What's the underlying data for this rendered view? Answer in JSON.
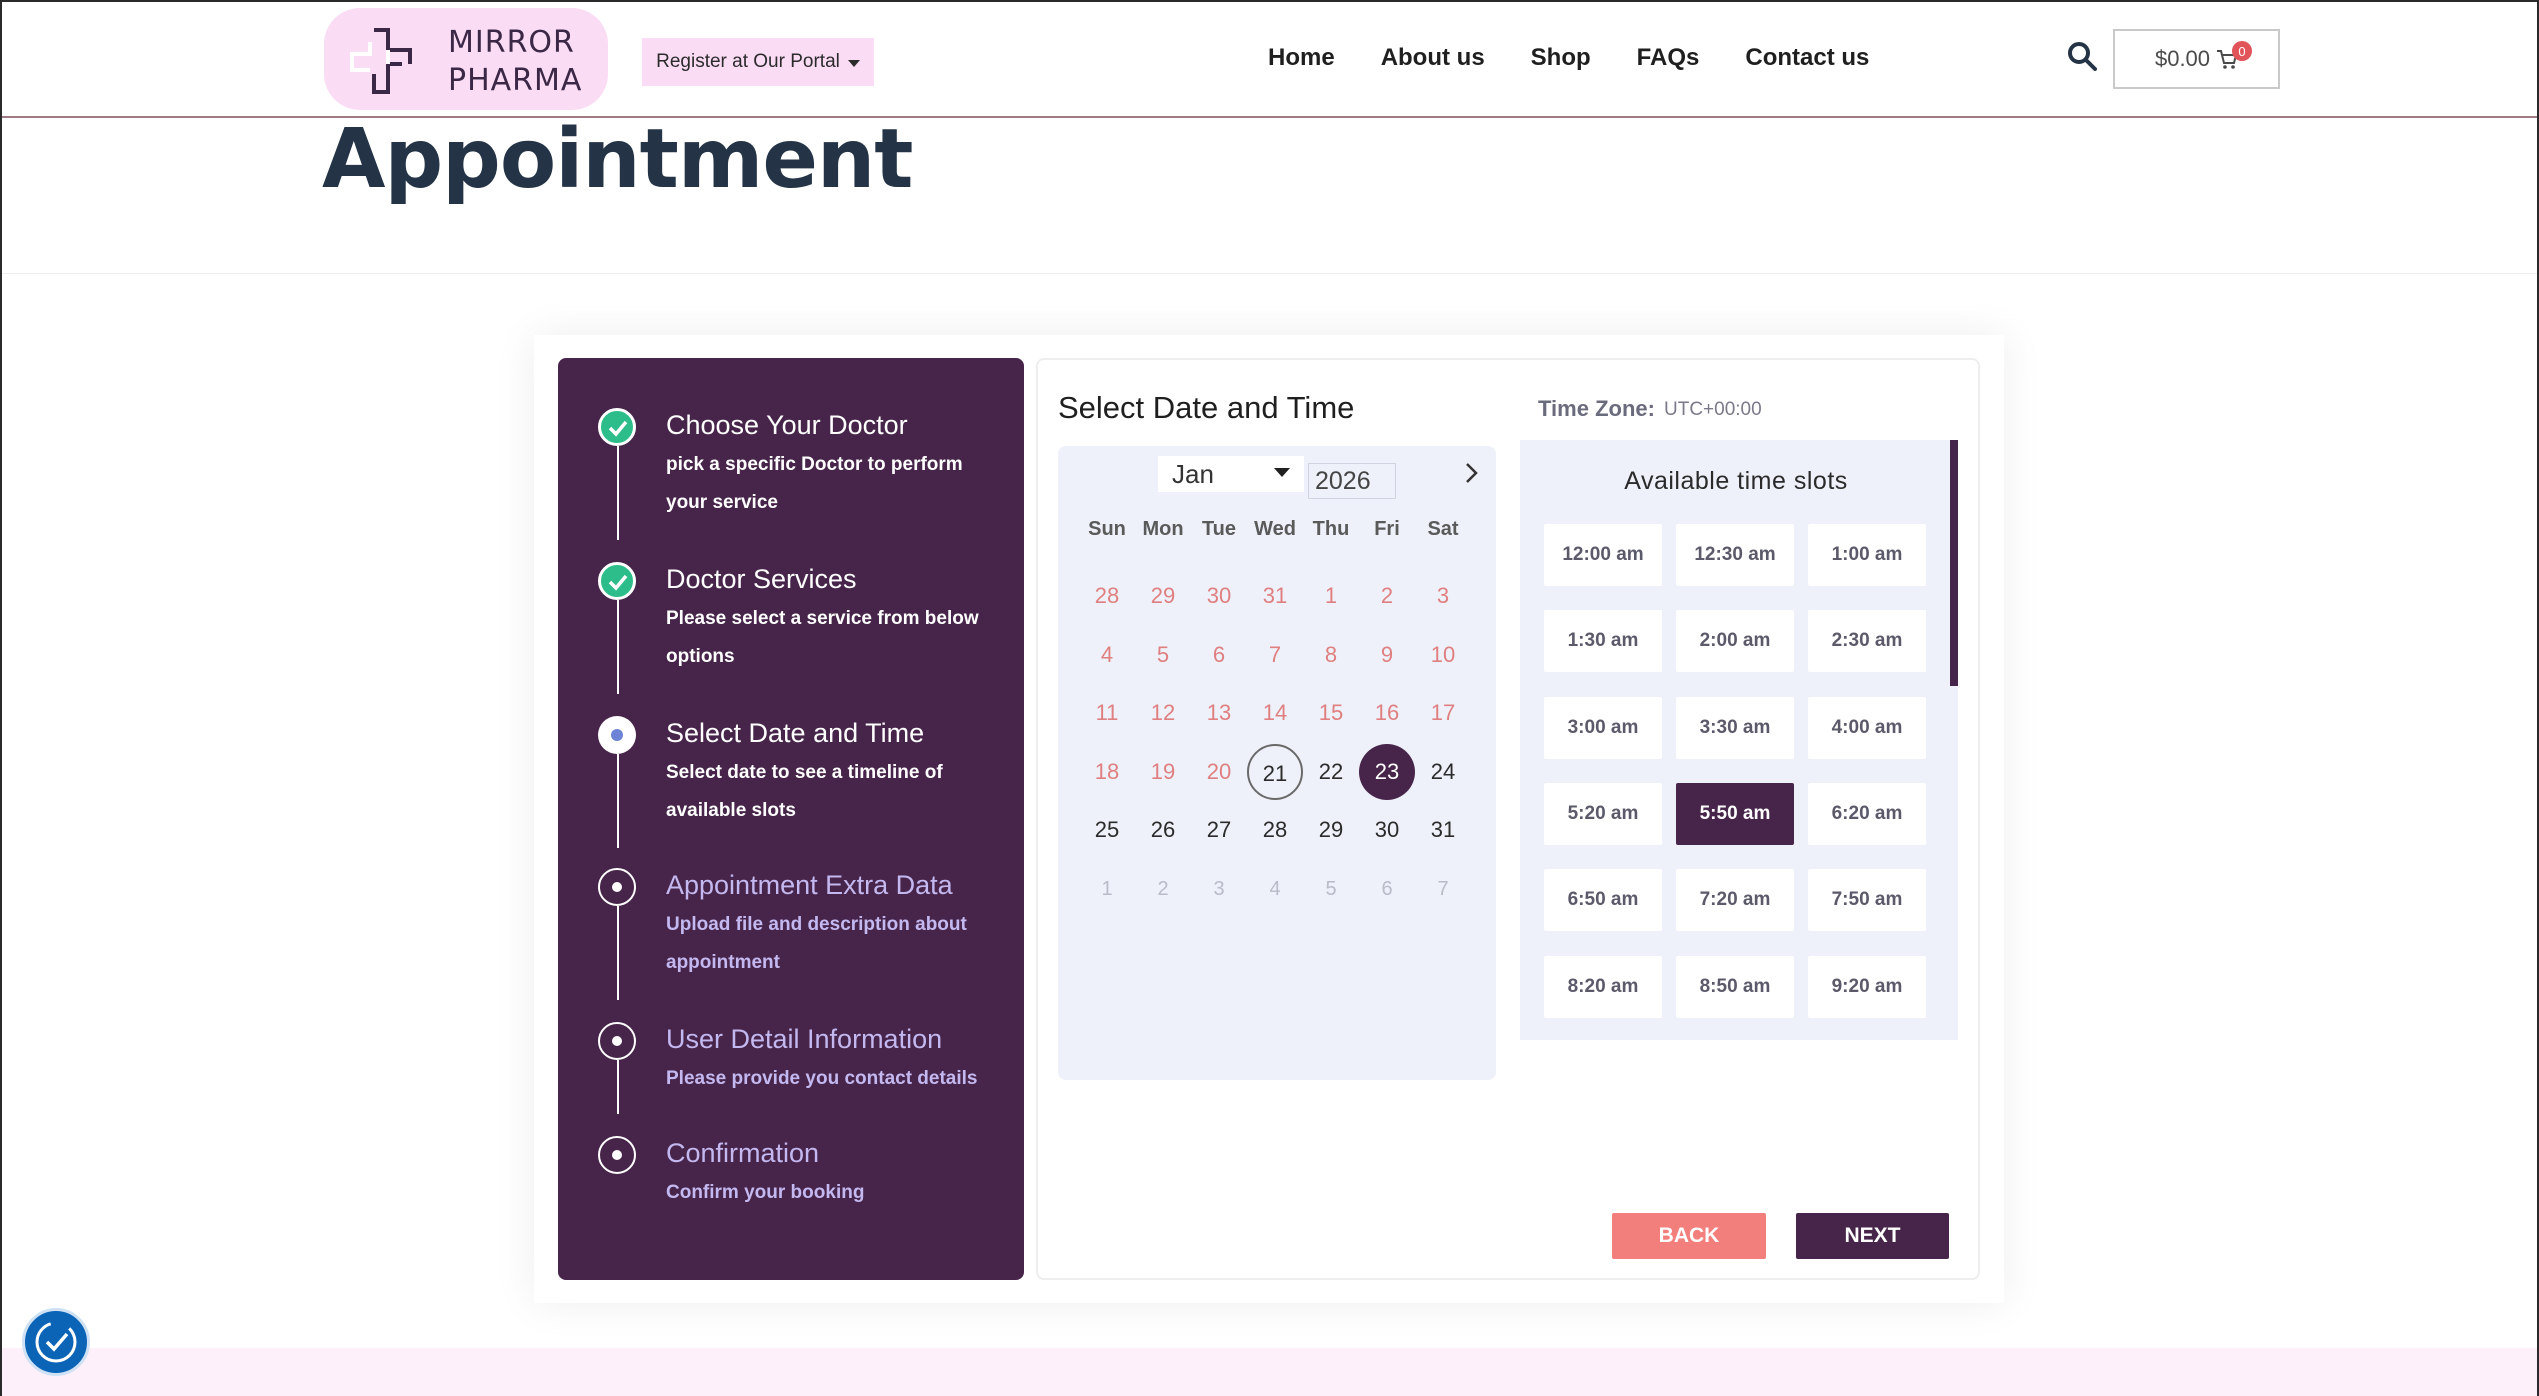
{
  "header": {
    "logo_line1": "MIRROR",
    "logo_line2": "PHARMA",
    "portal_label": "Register at Our Portal",
    "nav": [
      "Home",
      "About us",
      "Shop",
      "FAQs",
      "Contact us"
    ],
    "cart_total": "$0.00",
    "cart_count": "0"
  },
  "page": {
    "title": "Appointment"
  },
  "steps": [
    {
      "title": "Choose Your Doctor",
      "desc": "pick a specific Doctor to perform your service",
      "state": "done"
    },
    {
      "title": "Doctor Services",
      "desc": "Please select a service from below options",
      "state": "done"
    },
    {
      "title": "Select Date and Time",
      "desc": "Select date to see a timeline of available slots",
      "state": "current"
    },
    {
      "title": "Appointment Extra Data",
      "desc": "Upload file and description about appointment",
      "state": "pending"
    },
    {
      "title": "User Detail Information",
      "desc": "Please provide you contact details",
      "state": "pending"
    },
    {
      "title": "Confirmation",
      "desc": "Confirm your booking",
      "state": "pending"
    }
  ],
  "datetime": {
    "section_title": "Select Date and Time",
    "timezone_label": "Time Zone:",
    "timezone_value": "UTC+00:00"
  },
  "calendar": {
    "month": "Jan",
    "year": "2026",
    "weekdays": [
      "Sun",
      "Mon",
      "Tue",
      "Wed",
      "Thu",
      "Fri",
      "Sat"
    ],
    "weeks": [
      [
        "28",
        "29",
        "30",
        "31",
        "1",
        "2",
        "3"
      ],
      [
        "4",
        "5",
        "6",
        "7",
        "8",
        "9",
        "10"
      ],
      [
        "11",
        "12",
        "13",
        "14",
        "15",
        "16",
        "17"
      ],
      [
        "18",
        "19",
        "20",
        "21",
        "22",
        "23",
        "24"
      ],
      [
        "25",
        "26",
        "27",
        "28",
        "29",
        "30",
        "31"
      ],
      [
        "1",
        "2",
        "3",
        "4",
        "5",
        "6",
        "7"
      ]
    ],
    "today": "21",
    "selected": "23"
  },
  "slots": {
    "title": "Available time slots",
    "times": [
      "12:00 am",
      "12:30 am",
      "1:00 am",
      "1:30 am",
      "2:00 am",
      "2:30 am",
      "3:00 am",
      "3:30 am",
      "4:00 am",
      "5:20 am",
      "5:50 am",
      "6:20 am",
      "6:50 am",
      "7:20 am",
      "7:50 am",
      "8:20 am",
      "8:50 am",
      "9:20 am"
    ],
    "selected": "5:50 am"
  },
  "buttons": {
    "back": "BACK",
    "next": "NEXT"
  },
  "colors": {
    "brand": "#47254a",
    "accent_pink": "#fbdcf5",
    "done_green": "#2dbd8a",
    "back_button": "#f27f7b",
    "past_day": "#e07f80"
  }
}
